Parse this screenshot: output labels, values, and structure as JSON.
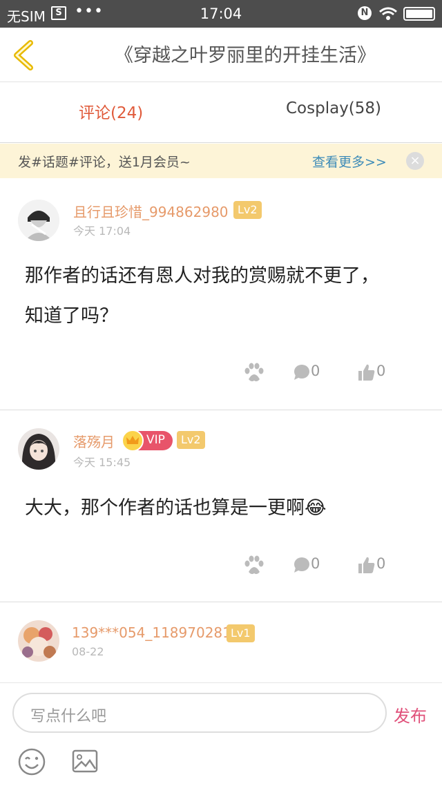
{
  "status_bar": {
    "carrier": "无SIM",
    "sim_icon": "sim-card-icon",
    "dots": "•••",
    "time": "17:04",
    "nfc": "N"
  },
  "header": {
    "title": "《穿越之叶罗丽里的开挂生活》",
    "back_icon": "chevron-left-icon"
  },
  "tabs": [
    {
      "label": "评论(24)",
      "active": true
    },
    {
      "label": "Cosplay(58)",
      "active": false
    }
  ],
  "promo": {
    "text": "发#话题#评论，送1月会员~",
    "link": "查看更多>>",
    "close": "×"
  },
  "comments": [
    {
      "username": "且行且珍惜_994862980",
      "level": "Lv2",
      "vip": null,
      "timestamp": "今天 17:04",
      "text": "那作者的话还有恩人对我的赏赐就不更了，知道了吗？",
      "comment_count": "0",
      "like_count": "0"
    },
    {
      "username": "落殇月",
      "level": "Lv2",
      "vip": "VIP",
      "timestamp": "今天 15:45",
      "text": "大大，那个作者的话也算是一更啊😂",
      "comment_count": "0",
      "like_count": "0"
    },
    {
      "username": "139***054_118970281",
      "level": "Lv1",
      "vip": null,
      "timestamp": "08-22"
    }
  ],
  "bottom_bar": {
    "placeholder": "写点什么吧",
    "publish_label": "发布"
  },
  "colors": {
    "accent": "#e05a3a",
    "username": "#e69a6a",
    "level_badge": "#f3c96d",
    "vip_badge": "#e8546a",
    "promo_bg": "#fdf4d7",
    "link": "#3d8bb8",
    "publish": "#e0507a"
  }
}
